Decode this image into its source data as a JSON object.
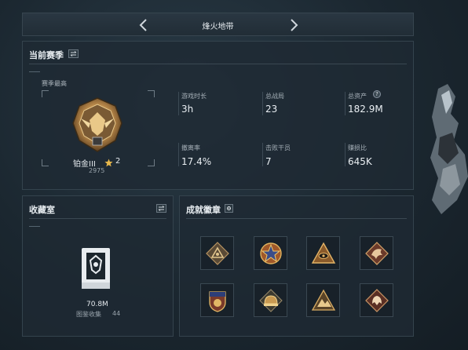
{
  "header": {
    "title": "烽火地带"
  },
  "season": {
    "title": "当前赛季",
    "peak_label": "赛季最高",
    "rank_name": "铂金III",
    "rank_stars": "2",
    "rank_score": "2975",
    "stats": [
      {
        "label": "游戏时长",
        "value": "3h"
      },
      {
        "label": "总战局",
        "value": "23"
      },
      {
        "label": "总资产",
        "value": "182.9M"
      },
      {
        "label": "撤离率",
        "value": "17.4%"
      },
      {
        "label": "击败干员",
        "value": "7"
      },
      {
        "label": "赚损比",
        "value": "645K"
      }
    ]
  },
  "collection": {
    "title": "收藏室",
    "value": "70.8M",
    "count_label": "图鉴收集",
    "count": "44"
  },
  "badges": {
    "title": "成就徽章",
    "items": [
      {
        "name": "pyramid-badge"
      },
      {
        "name": "star-shield-badge"
      },
      {
        "name": "eye-triangle-badge"
      },
      {
        "name": "dragon-badge"
      },
      {
        "name": "crest-badge"
      },
      {
        "name": "helmet-badge"
      },
      {
        "name": "mountain-badge"
      },
      {
        "name": "beast-badge"
      }
    ]
  },
  "colors": {
    "accent_gold": "#c9a060",
    "panel_bg": "#1f2a33",
    "text": "#d7dde2"
  },
  "icons": {
    "prev": "chevron-left-icon",
    "next": "chevron-right-icon",
    "swap": "swap-icon",
    "settings": "gear-icon",
    "help": "question-icon",
    "star": "star-icon"
  }
}
